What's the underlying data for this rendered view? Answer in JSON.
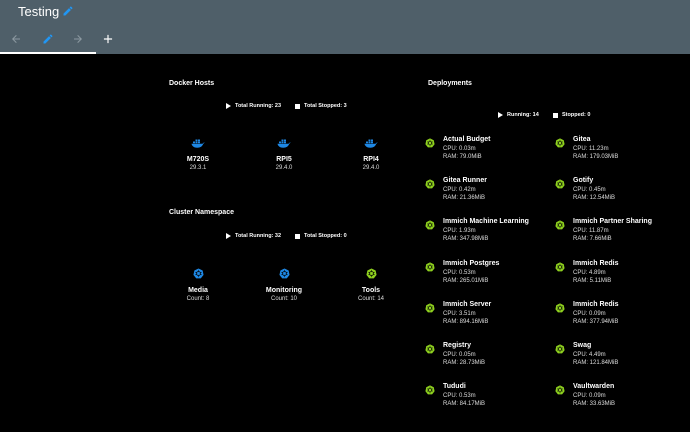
{
  "header": {
    "title": "Testing"
  },
  "tabs": [],
  "colors": {
    "topbar": "#4f5f69",
    "docker_blue": "#1e88e5",
    "k8s_green": "#8fd11f",
    "k8s_blue": "#1e88e5"
  },
  "docker_hosts": {
    "title": "Docker Hosts",
    "running": "Total Running: 23",
    "stopped": "Total Stopped: 3",
    "hosts": [
      {
        "name": "M720S",
        "version": "29.3.1"
      },
      {
        "name": "RPI5",
        "version": "29.4.0"
      },
      {
        "name": "RPI4",
        "version": "29.4.0"
      }
    ]
  },
  "cluster": {
    "title": "Cluster Namespace",
    "running": "Total Running: 32",
    "stopped": "Total Stopped: 0",
    "namespaces": [
      {
        "name": "Media",
        "count": "Count: 8",
        "color": "#1e88e5"
      },
      {
        "name": "Monitoring",
        "count": "Count: 10",
        "color": "#1e88e5"
      },
      {
        "name": "Tools",
        "count": "Count: 14",
        "color": "#8fd11f"
      }
    ]
  },
  "deployments": {
    "title": "Deployments",
    "running": "Running: 14",
    "stopped": "Stopped: 0",
    "items": [
      {
        "name": "Actual Budget",
        "cpu": "CPU: 0.03m",
        "ram": "RAM: 79.0MiB"
      },
      {
        "name": "Gitea",
        "cpu": "CPU: 11.23m",
        "ram": "RAM: 179.03MiB"
      },
      {
        "name": "Gitea Runner",
        "cpu": "CPU: 0.42m",
        "ram": "RAM: 21.36MiB"
      },
      {
        "name": "Gotify",
        "cpu": "CPU: 0.45m",
        "ram": "RAM: 12.54MiB"
      },
      {
        "name": "Immich Machine Learning",
        "cpu": "CPU: 1.93m",
        "ram": "RAM: 347.98MiB"
      },
      {
        "name": "Immich Partner Sharing",
        "cpu": "CPU: 11.87m",
        "ram": "RAM: 7.66MiB"
      },
      {
        "name": "Immich Postgres",
        "cpu": "CPU: 0.53m",
        "ram": "RAM: 265.01MiB"
      },
      {
        "name": "Immich Redis",
        "cpu": "CPU: 4.89m",
        "ram": "RAM: 5.11MiB"
      },
      {
        "name": "Immich Server",
        "cpu": "CPU: 3.51m",
        "ram": "RAM: 894.16MiB"
      },
      {
        "name": "Immich Redis",
        "cpu": "CPU: 0.09m",
        "ram": "RAM: 377.94MiB"
      },
      {
        "name": "Registry",
        "cpu": "CPU: 0.05m",
        "ram": "RAM: 28.73MiB"
      },
      {
        "name": "Swag",
        "cpu": "CPU: 4.49m",
        "ram": "RAM: 121.84MiB"
      },
      {
        "name": "Tududi",
        "cpu": "CPU: 0.53m",
        "ram": "RAM: 84.17MiB"
      },
      {
        "name": "Vaultwarden",
        "cpu": "CPU: 0.09m",
        "ram": "RAM: 33.63MiB"
      }
    ]
  }
}
